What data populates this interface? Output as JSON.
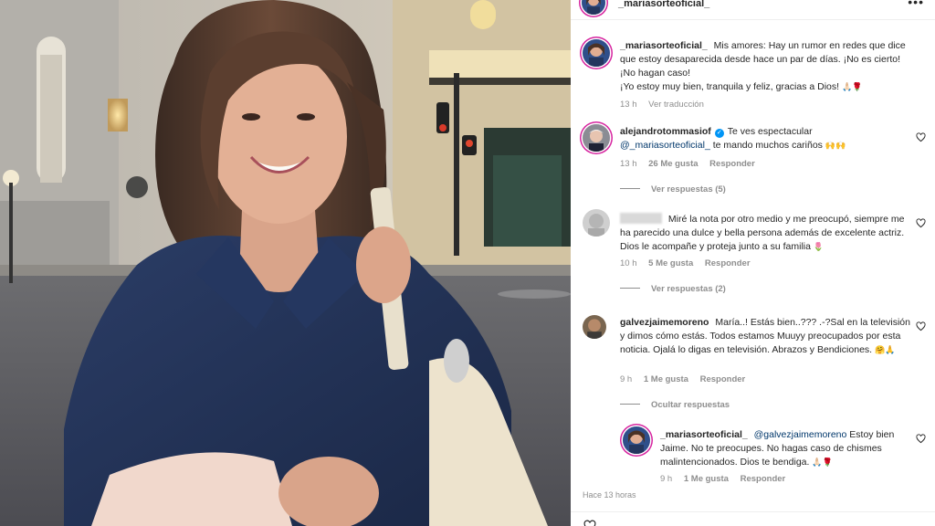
{
  "post": {
    "author": "_mariasorteoficial_",
    "more_icon": "more-horizontal-icon",
    "caption_user": "_mariasorteoficial_",
    "caption_text": "Mis amores: Hay un rumor en redes que dice que estoy desaparecida desde hace un par de días. ¡No es cierto! ¡No hagan caso!",
    "caption_text_2": "¡Yo estoy muy bien, tranquila y feliz, gracias a Dios!",
    "caption_emoji": "🙏🏻🌹",
    "caption_time": "13 h",
    "caption_translate": "Ver traducción",
    "post_time": "Hace 13 horas"
  },
  "comments": [
    {
      "user": "alejandrotommasiof",
      "verified": true,
      "mention": "@_mariasorteoficial_",
      "text_before": "Te ves espectacular",
      "text_after": "te mando muchos cariños",
      "emoji": "🙌🙌",
      "time": "13 h",
      "likes": "26 Me gusta",
      "reply": "Responder",
      "view_replies": "Ver respuestas (5)"
    },
    {
      "user": "",
      "text": "Miré la nota por otro medio y me preocupó, siempre me ha parecido una dulce y bella persona además de excelente actriz. Dios le acompañe y proteja junto a su familia",
      "emoji": "🌷",
      "time": "10 h",
      "likes": "5 Me gusta",
      "reply": "Responder",
      "view_replies": "Ver respuestas (2)"
    },
    {
      "user": "galvezjaimemoreno",
      "text": "María..! Estás bien..??? .-?Sal en la televisión y dimos cómo estás. Todos estamos Muuyy preocupados por esta noticia. Ojalá lo digas en televisión. Abrazos y Bendiciones.",
      "emoji": "🤗🙏",
      "time": "9 h",
      "likes": "1 Me gusta",
      "reply": "Responder",
      "view_replies": "Ocultar respuestas"
    }
  ],
  "reply": {
    "user": "_mariasorteoficial_",
    "mention": "@galvezjaimemoreno",
    "text": "Estoy bien Jaime. No te preocupes. No hagas caso de chismes malintencionados. Dios te bendiga.",
    "emoji": "🙏🏻🌹",
    "time": "9 h",
    "likes": "1 Me gusta",
    "reply": "Responder"
  },
  "colors": {
    "ring": "#d6249f",
    "verified": "#0095f6",
    "mention": "#00376b",
    "muted": "#8e8e8e"
  }
}
